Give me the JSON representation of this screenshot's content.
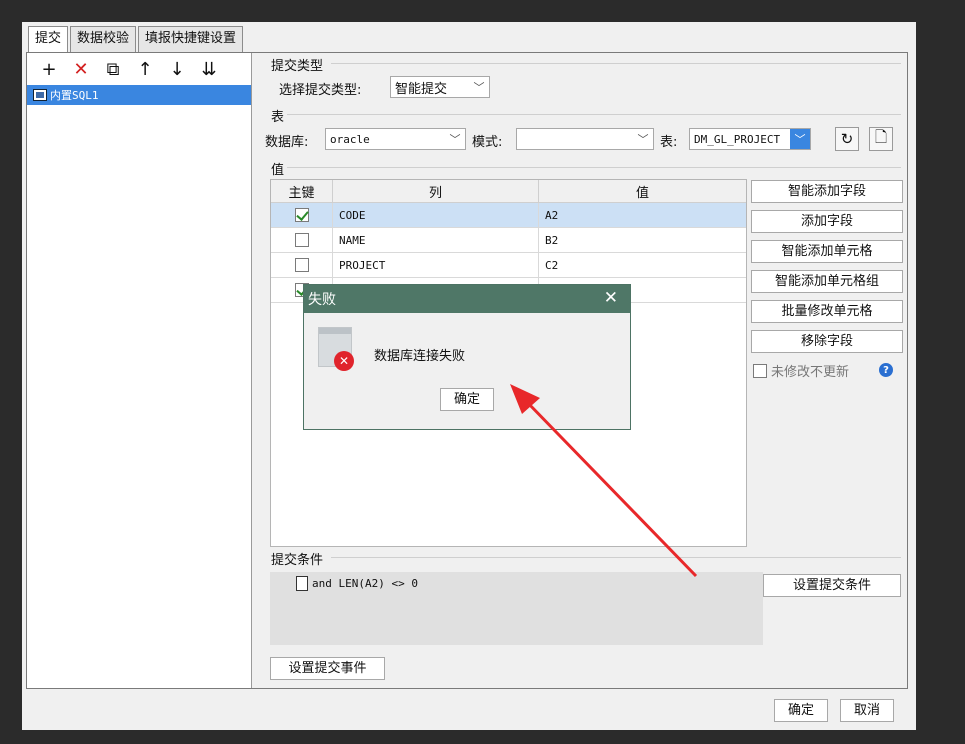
{
  "tabs": [
    "提交",
    "数据校验",
    "填报快捷键设置"
  ],
  "left_pane": {
    "tree_item": "内置SQL1"
  },
  "submit_type": {
    "group_title": "提交类型",
    "label": "选择提交类型:",
    "value": "智能提交"
  },
  "table": {
    "group_title": "表",
    "db_label": "数据库:",
    "db_value": "oracle",
    "mode_label": "模式:",
    "mode_value": "",
    "table_label": "表:",
    "table_value": "DM_GL_PROJECT"
  },
  "values": {
    "group_title": "值",
    "headers": [
      "主键",
      "列",
      "值"
    ],
    "rows": [
      {
        "pk": true,
        "col": "CODE",
        "val": "A2"
      },
      {
        "pk": false,
        "col": "NAME",
        "val": "B2"
      },
      {
        "pk": false,
        "col": "PROJECT",
        "val": "C2"
      },
      {
        "pk": true,
        "col": "",
        "val": ""
      }
    ]
  },
  "side_buttons": [
    "智能添加字段",
    "添加字段",
    "智能添加单元格",
    "智能添加单元格组",
    "批量修改单元格",
    "移除字段"
  ],
  "no_modify_label": "未修改不更新",
  "condition": {
    "group_title": "提交条件",
    "item": "and LEN(A2) <> 0",
    "button": "设置提交条件"
  },
  "event_button": "设置提交事件",
  "footer": {
    "ok": "确定",
    "cancel": "取消"
  },
  "dialog": {
    "title": "失败",
    "message": "数据库连接失败",
    "ok": "确定"
  },
  "colors": {
    "accent_blue": "#3a86e0",
    "dialog_header": "#4f7767",
    "error_red": "#e0242c",
    "arrow_red": "#e8282a"
  }
}
